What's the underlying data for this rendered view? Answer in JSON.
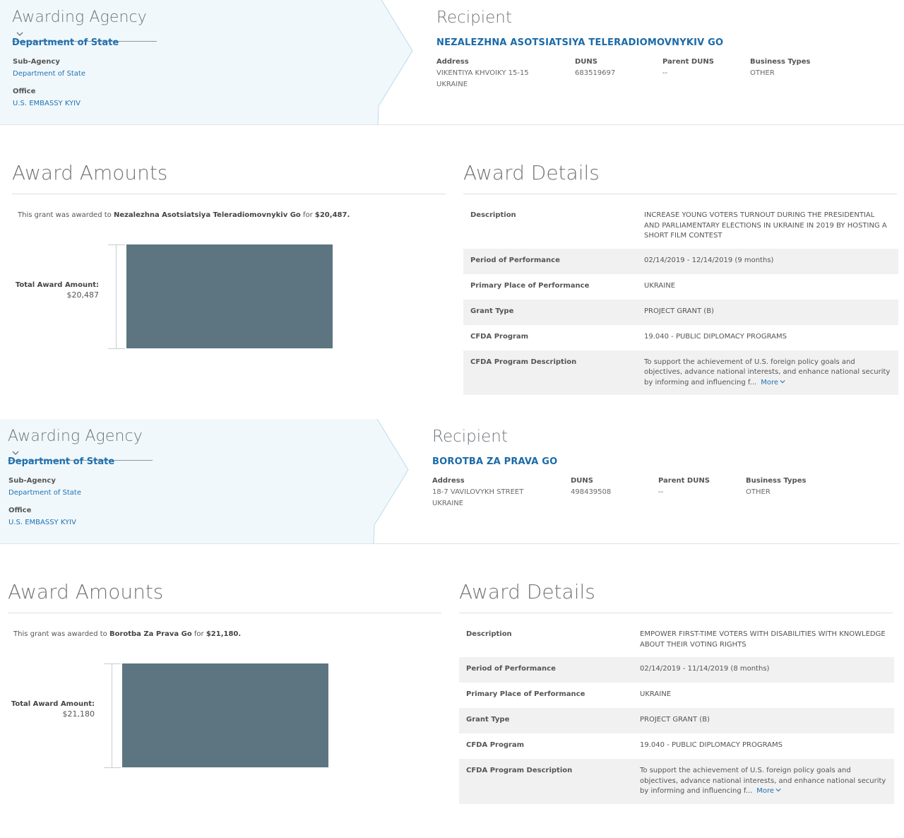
{
  "awards": [
    {
      "agency": {
        "title": "Awarding Agency",
        "name": "Department of State",
        "sub_agency_label": "Sub-Agency",
        "sub_agency": "Department of State",
        "office_label": "Office",
        "office": "U.S. EMBASSY KYIV"
      },
      "recipient": {
        "title": "Recipient",
        "name": "NEZALEZHNA ASOTSIATSIYA TELERADIOMOVNYKIV GO",
        "address_label": "Address",
        "address_line1": "VIKENTIYA KHVOIKY 15-15",
        "address_line2": "UKRAINE",
        "duns_label": "DUNS",
        "duns": "683519697",
        "parent_duns_label": "Parent DUNS",
        "parent_duns": "--",
        "business_types_label": "Business Types",
        "business_types": "OTHER"
      },
      "amounts": {
        "title": "Award Amounts",
        "sentence_prefix": "This grant was awarded to ",
        "recipient_display": "Nezalezhna Asotsiatsiya Teleradiomovnykiv Go",
        "sentence_mid": " for ",
        "amount_text": "$20,487.",
        "total_label": "Total Award Amount:",
        "total_value": "$20,487",
        "total_number": 20487
      },
      "details": {
        "title": "Award Details",
        "rows": [
          {
            "key": "Description",
            "value": "INCREASE YOUNG VOTERS TURNOUT DURING THE PRESIDENTIAL AND PARLIAMENTARY ELECTIONS IN UKRAINE IN 2019 BY HOSTING A SHORT FILM CONTEST"
          },
          {
            "key": "Period of Performance",
            "value": "02/14/2019 - 12/14/2019 (9 months)"
          },
          {
            "key": "Primary Place of Performance",
            "value": "UKRAINE"
          },
          {
            "key": "Grant Type",
            "value": "PROJECT GRANT (B)"
          },
          {
            "key": "CFDA Program",
            "value": "19.040 - PUBLIC DIPLOMACY PROGRAMS"
          },
          {
            "key": "CFDA Program Description",
            "value": "To support the achievement of U.S. foreign policy goals and objectives, advance national interests, and enhance national security by informing and influencing f...",
            "more": "More"
          }
        ]
      }
    },
    {
      "agency": {
        "title": "Awarding Agency",
        "name": "Department of State",
        "sub_agency_label": "Sub-Agency",
        "sub_agency": "Department of State",
        "office_label": "Office",
        "office": "U.S. EMBASSY KYIV"
      },
      "recipient": {
        "title": "Recipient",
        "name": "BOROTBA ZA PRAVA GO",
        "address_label": "Address",
        "address_line1": "18-7 VAVILOVYKH STREET",
        "address_line2": "UKRAINE",
        "duns_label": "DUNS",
        "duns": "498439508",
        "parent_duns_label": "Parent DUNS",
        "parent_duns": "--",
        "business_types_label": "Business Types",
        "business_types": "OTHER"
      },
      "amounts": {
        "title": "Award Amounts",
        "sentence_prefix": "This grant was awarded to ",
        "recipient_display": "Borotba Za Prava Go",
        "sentence_mid": " for ",
        "amount_text": "$21,180.",
        "total_label": "Total Award Amount:",
        "total_value": "$21,180",
        "total_number": 21180
      },
      "details": {
        "title": "Award Details",
        "rows": [
          {
            "key": "Description",
            "value": "EMPOWER FIRST-TIME VOTERS WITH DISABILITIES WITH KNOWLEDGE ABOUT THEIR VOTING RIGHTS"
          },
          {
            "key": "Period of Performance",
            "value": "02/14/2019 - 11/14/2019 (8 months)"
          },
          {
            "key": "Primary Place of Performance",
            "value": "UKRAINE"
          },
          {
            "key": "Grant Type",
            "value": "PROJECT GRANT (B)"
          },
          {
            "key": "CFDA Program",
            "value": "19.040 - PUBLIC DIPLOMACY PROGRAMS"
          },
          {
            "key": "CFDA Program Description",
            "value": "To support the achievement of U.S. foreign policy goals and objectives, advance national interests, and enhance national security by informing and influencing f...",
            "more": "More"
          }
        ]
      }
    }
  ],
  "colors": {
    "agency_band": "#f1f8fb",
    "link_blue": "#2071b1",
    "bar_fill": "#5c7580"
  }
}
